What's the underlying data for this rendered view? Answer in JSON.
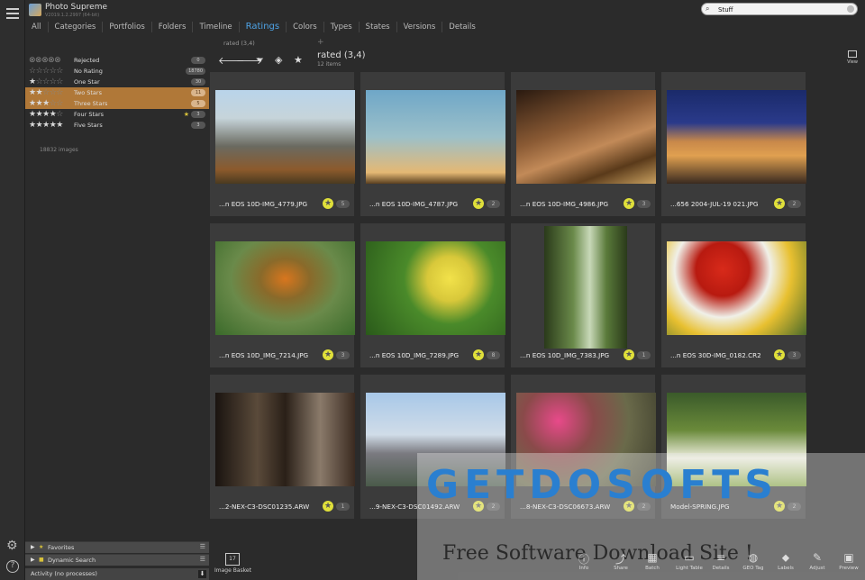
{
  "app": {
    "name": "Photo Supreme",
    "version": "V2019.1.2.2997 (64-bit)"
  },
  "search": {
    "value": "Stuff"
  },
  "tabs": [
    "All",
    "Categories",
    "Portfolios",
    "Folders",
    "Timeline",
    "Ratings",
    "Colors",
    "Types",
    "States",
    "Versions",
    "Details"
  ],
  "active_tab": "Ratings",
  "ratings": [
    {
      "label": "Rejected",
      "count": "0"
    },
    {
      "label": "No Rating",
      "count": "18780"
    },
    {
      "label": "One Star",
      "count": "30"
    },
    {
      "label": "Two Stars",
      "count": "11"
    },
    {
      "label": "Three Stars",
      "count": "5"
    },
    {
      "label": "Four Stars",
      "count": "3"
    },
    {
      "label": "Five Stars",
      "count": "3"
    }
  ],
  "images_total": "18832 images",
  "breadcrumb": "rated  (3,4)",
  "content": {
    "title": "rated  (3,4)",
    "subtitle": "12 items"
  },
  "view_label": "View",
  "photos": [
    {
      "name": "...n EOS 10D-IMG_4779.JPG",
      "count": "5"
    },
    {
      "name": "...n EOS 10D-IMG_4787.JPG",
      "count": "2"
    },
    {
      "name": "...n EOS 10D-IMG_4986.JPG",
      "count": "3"
    },
    {
      "name": "...656 2004-JUL-19 021.JPG",
      "count": "2"
    },
    {
      "name": "...n EOS 10D_IMG_7214.JPG",
      "count": "3"
    },
    {
      "name": "...n EOS 10D_IMG_7289.JPG",
      "count": "8"
    },
    {
      "name": "...n EOS 10D_IMG_7383.JPG",
      "count": "1"
    },
    {
      "name": "...n EOS 30D-IMG_0182.CR2",
      "count": "3"
    },
    {
      "name": "...2-NEX-C3-DSC01235.ARW",
      "count": "1"
    },
    {
      "name": "...9-NEX-C3-DSC01492.ARW",
      "count": "2"
    },
    {
      "name": "...8-NEX-C3-DSC06673.ARW",
      "count": "2"
    },
    {
      "name": "Model-SPRING.JPG",
      "count": "2"
    }
  ],
  "panels": {
    "favorites": "Favorites",
    "dynamic_search": "Dynamic Search",
    "activity": "Activity (no processes)"
  },
  "basket": {
    "label": "Image Basket",
    "count": "17"
  },
  "bottom_tools": [
    "Info",
    "Share",
    "Batch",
    "Light Table",
    "Details",
    "GEO Tag",
    "Labels",
    "Adjust",
    "Preview"
  ],
  "watermark": {
    "logo": "GETDOSOFTS",
    "tagline": "Free Software Download Site !"
  }
}
